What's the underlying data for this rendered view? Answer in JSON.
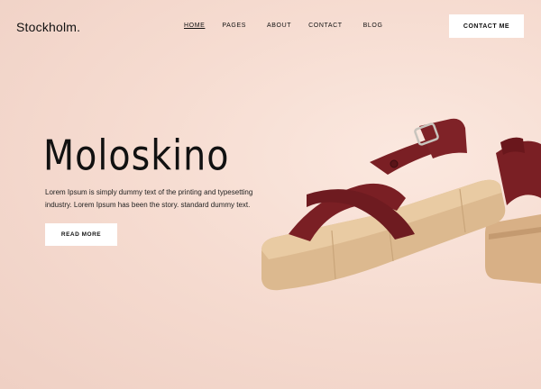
{
  "header": {
    "logo": "Stockholm.",
    "nav": [
      {
        "label": "HOME"
      },
      {
        "label": "PAGES"
      },
      {
        "label": "ABOUT"
      },
      {
        "label": "CONTACT"
      },
      {
        "label": "BLOG"
      }
    ],
    "contact_button": "CONTACT ME"
  },
  "hero": {
    "title": "Moloskino",
    "description": "Lorem Ipsum is simply dummy text of the printing and typesetting industry. Lorem Ipsum has been the story. standard dummy text.",
    "button": "READ MORE"
  },
  "colors": {
    "background": "#f5ddd3",
    "strap": "#7a1f24",
    "sole": "#d9b48a"
  },
  "image": {
    "icon": "sandal-product-image"
  }
}
